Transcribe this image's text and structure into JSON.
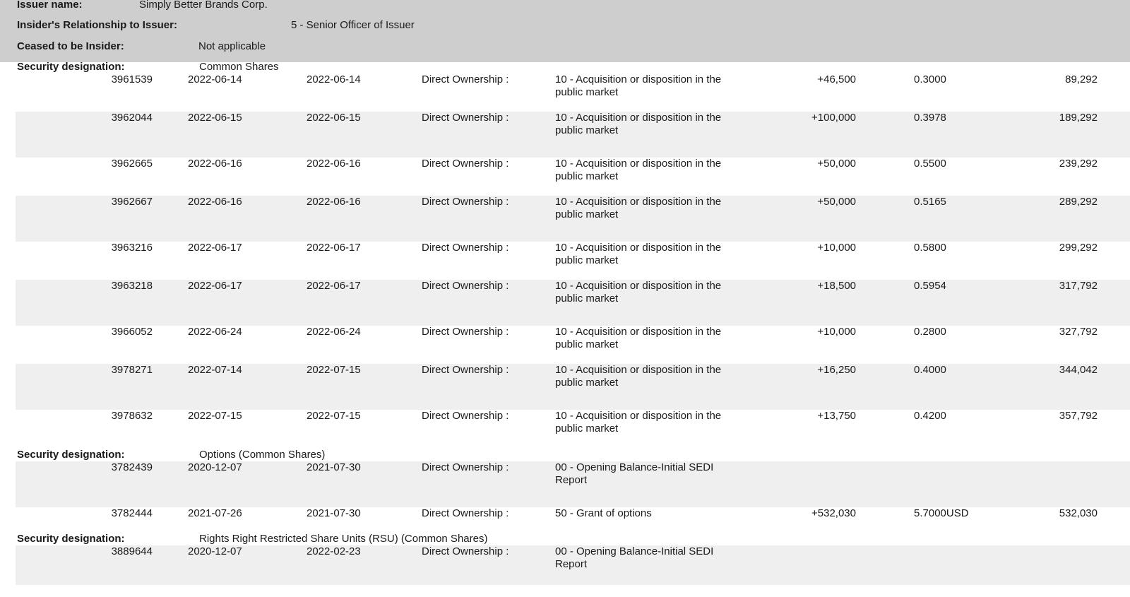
{
  "header": {
    "issuer_label": "Issuer name:",
    "issuer_value": "Simply Better Brands Corp.",
    "relationship_label": "Insider's Relationship to Issuer:",
    "relationship_value": "5 - Senior Officer of Issuer",
    "ceased_label": "Ceased to be Insider:",
    "ceased_value": "Not applicable"
  },
  "sections": [
    {
      "label": "Security designation:",
      "value": "Common Shares",
      "rows": [
        {
          "id": "3961539",
          "date1": "2022-06-14",
          "date2": "2022-06-14",
          "ownership": "Direct Ownership :",
          "nature": "10 - Acquisition or disposition in the public market",
          "number": "+46,500",
          "price": "0.3000",
          "balance": "89,292"
        },
        {
          "id": "3962044",
          "date1": "2022-06-15",
          "date2": "2022-06-15",
          "ownership": "Direct Ownership :",
          "nature": "10 - Acquisition or disposition in the public market",
          "number": "+100,000",
          "price": "0.3978",
          "balance": "189,292"
        },
        {
          "id": "3962665",
          "date1": "2022-06-16",
          "date2": "2022-06-16",
          "ownership": "Direct Ownership :",
          "nature": "10 - Acquisition or disposition in the public market",
          "number": "+50,000",
          "price": "0.5500",
          "balance": "239,292"
        },
        {
          "id": "3962667",
          "date1": "2022-06-16",
          "date2": "2022-06-16",
          "ownership": "Direct Ownership :",
          "nature": "10 - Acquisition or disposition in the public market",
          "number": "+50,000",
          "price": "0.5165",
          "balance": "289,292"
        },
        {
          "id": "3963216",
          "date1": "2022-06-17",
          "date2": "2022-06-17",
          "ownership": "Direct Ownership :",
          "nature": "10 - Acquisition or disposition in the public market",
          "number": "+10,000",
          "price": "0.5800",
          "balance": "299,292"
        },
        {
          "id": "3963218",
          "date1": "2022-06-17",
          "date2": "2022-06-17",
          "ownership": "Direct Ownership :",
          "nature": "10 - Acquisition or disposition in the public market",
          "number": "+18,500",
          "price": "0.5954",
          "balance": "317,792"
        },
        {
          "id": "3966052",
          "date1": "2022-06-24",
          "date2": "2022-06-24",
          "ownership": "Direct Ownership :",
          "nature": "10 - Acquisition or disposition in the public market",
          "number": "+10,000",
          "price": "0.2800",
          "balance": "327,792"
        },
        {
          "id": "3978271",
          "date1": "2022-07-14",
          "date2": "2022-07-15",
          "ownership": "Direct Ownership :",
          "nature": "10 - Acquisition or disposition in the public market",
          "number": "+16,250",
          "price": "0.4000",
          "balance": "344,042"
        },
        {
          "id": "3978632",
          "date1": "2022-07-15",
          "date2": "2022-07-15",
          "ownership": "Direct Ownership :",
          "nature": "10 - Acquisition or disposition in the public market",
          "number": "+13,750",
          "price": "0.4200",
          "balance": "357,792"
        }
      ]
    },
    {
      "label": "Security designation:",
      "value": "Options (Common Shares)",
      "rows": [
        {
          "id": "3782439",
          "date1": "2020-12-07",
          "date2": "2021-07-30",
          "ownership": "Direct Ownership :",
          "nature": "00 - Opening Balance-Initial SEDI Report",
          "number": "",
          "price": "",
          "balance": ""
        },
        {
          "id": "3782444",
          "date1": "2021-07-26",
          "date2": "2021-07-30",
          "ownership": "Direct Ownership :",
          "nature": "50 - Grant of options",
          "number": "+532,030",
          "price": "5.7000USD",
          "balance": "532,030"
        }
      ]
    },
    {
      "label": "Security designation:",
      "value": "Rights Right Restricted Share Units (RSU) (Common Shares)",
      "rows": [
        {
          "id": "3889644",
          "date1": "2020-12-07",
          "date2": "2022-02-23",
          "ownership": "Direct Ownership :",
          "nature": "00 - Opening Balance-Initial SEDI Report",
          "number": "",
          "price": "",
          "balance": ""
        }
      ]
    }
  ]
}
